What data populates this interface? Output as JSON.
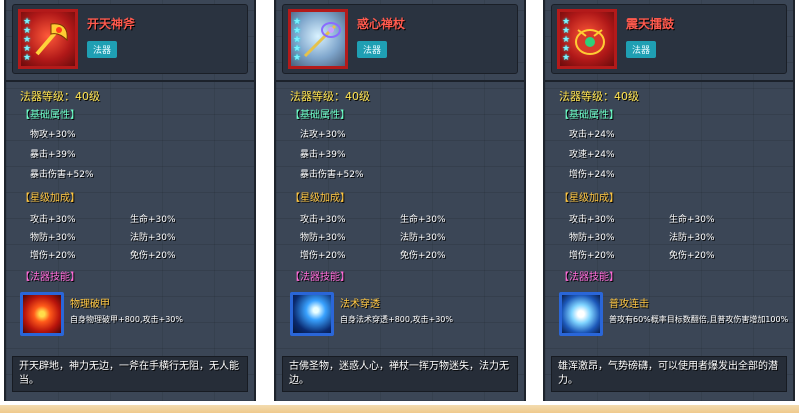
{
  "cards": [
    {
      "name": "开天神斧",
      "type": "法器",
      "level": "法器等级：40级",
      "base_title": "【基础属性】",
      "base": [
        "物攻+30%",
        "暴击+39%",
        "暴击伤害+52%"
      ],
      "star_title": "【星级加成】",
      "star_left": [
        "攻击+30%",
        "物防+30%",
        "增伤+20%"
      ],
      "star_right": [
        "生命+30%",
        "法防+30%",
        "免伤+20%"
      ],
      "skill_title": "【法器技能】",
      "skill_name": "物理破甲",
      "skill_desc": "自身物理破甲+800,攻击+30%",
      "description": "开天辟地，神力无边，一斧在手横行无阻，无人能当。"
    },
    {
      "name": "惑心禅杖",
      "type": "法器",
      "level": "法器等级：40级",
      "base_title": "【基础属性】",
      "base": [
        "法攻+30%",
        "暴击+39%",
        "暴击伤害+52%"
      ],
      "star_title": "【星级加成】",
      "star_left": [
        "攻击+30%",
        "物防+30%",
        "增伤+20%"
      ],
      "star_right": [
        "生命+30%",
        "法防+30%",
        "免伤+20%"
      ],
      "skill_title": "【法器技能】",
      "skill_name": "法术穿透",
      "skill_desc": "自身法术穿透+800,攻击+30%",
      "description": "古佛圣物，迷惑人心，禅杖一挥万物迷失，法力无边。"
    },
    {
      "name": "震天擂鼓",
      "type": "法器",
      "level": "法器等级：40级",
      "base_title": "【基础属性】",
      "base": [
        "攻击+24%",
        "攻速+24%",
        "增伤+24%"
      ],
      "star_title": "【星级加成】",
      "star_left": [
        "攻击+30%",
        "物防+30%",
        "增伤+20%"
      ],
      "star_right": [
        "生命+30%",
        "法防+30%",
        "免伤+20%"
      ],
      "skill_title": "【法器技能】",
      "skill_name": "普攻连击",
      "skill_desc": "普攻有60%概率目标数翻倍,且普攻伤害增加100%",
      "description": "雄浑激昂，气势磅礴，可以使用者爆发出全部的潜力。"
    }
  ],
  "star_glyph": "★",
  "colors": {
    "card_bg": "#3b4656",
    "item_name": "#ff5a4e",
    "level": "#ffe34f",
    "section_gold": "#ffc640",
    "section_green": "#6dffc8",
    "section_pink": "#ff6ad8",
    "type_badge": "#1f9fb3"
  }
}
